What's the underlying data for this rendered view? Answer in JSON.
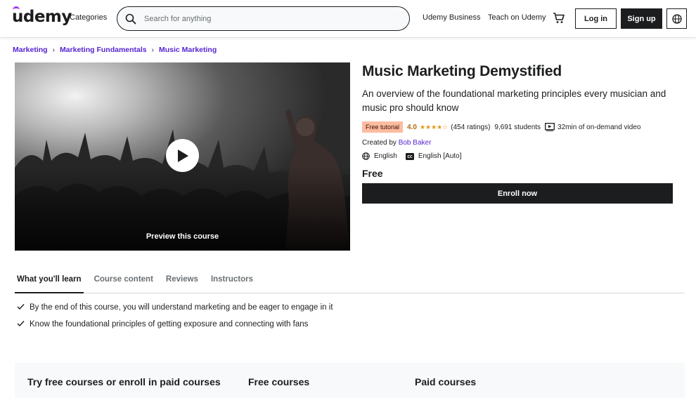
{
  "header": {
    "logo": "udemy",
    "categories": "Categories",
    "search_placeholder": "Search for anything",
    "udemy_business": "Udemy Business",
    "teach": "Teach on Udemy",
    "login": "Log in",
    "signup": "Sign up"
  },
  "breadcrumb": {
    "items": [
      "Marketing",
      "Marketing Fundamentals",
      "Music Marketing"
    ]
  },
  "video": {
    "preview_label": "Preview this course"
  },
  "course": {
    "title": "Music Marketing Demystified",
    "subtitle": "An overview of the foundational marketing principles every musician and music pro should know",
    "badge": "Free tutorial",
    "rating": "4.0",
    "rating_value": 4.0,
    "ratings_count": "(454 ratings)",
    "students": "9,691 students",
    "duration": "32min of on-demand video",
    "created_by_label": "Created by",
    "author": "Bob Baker",
    "language": "English",
    "captions": "English [Auto]",
    "price": "Free",
    "enroll": "Enroll now"
  },
  "tabs": [
    "What you'll learn",
    "Course content",
    "Reviews",
    "Instructors"
  ],
  "learn": [
    "By the end of this course, you will understand marketing and be eager to engage in it",
    "Know the foundational principles of getting exposure and connecting with fans"
  ],
  "panel": {
    "heading": "Try free courses or enroll in paid courses",
    "free": "Free courses",
    "paid": "Paid courses"
  },
  "colors": {
    "accent": "#5624d0",
    "brand_purple": "#a435f0",
    "rating": "#b4690e",
    "badge_bg": "#fcbca0"
  }
}
